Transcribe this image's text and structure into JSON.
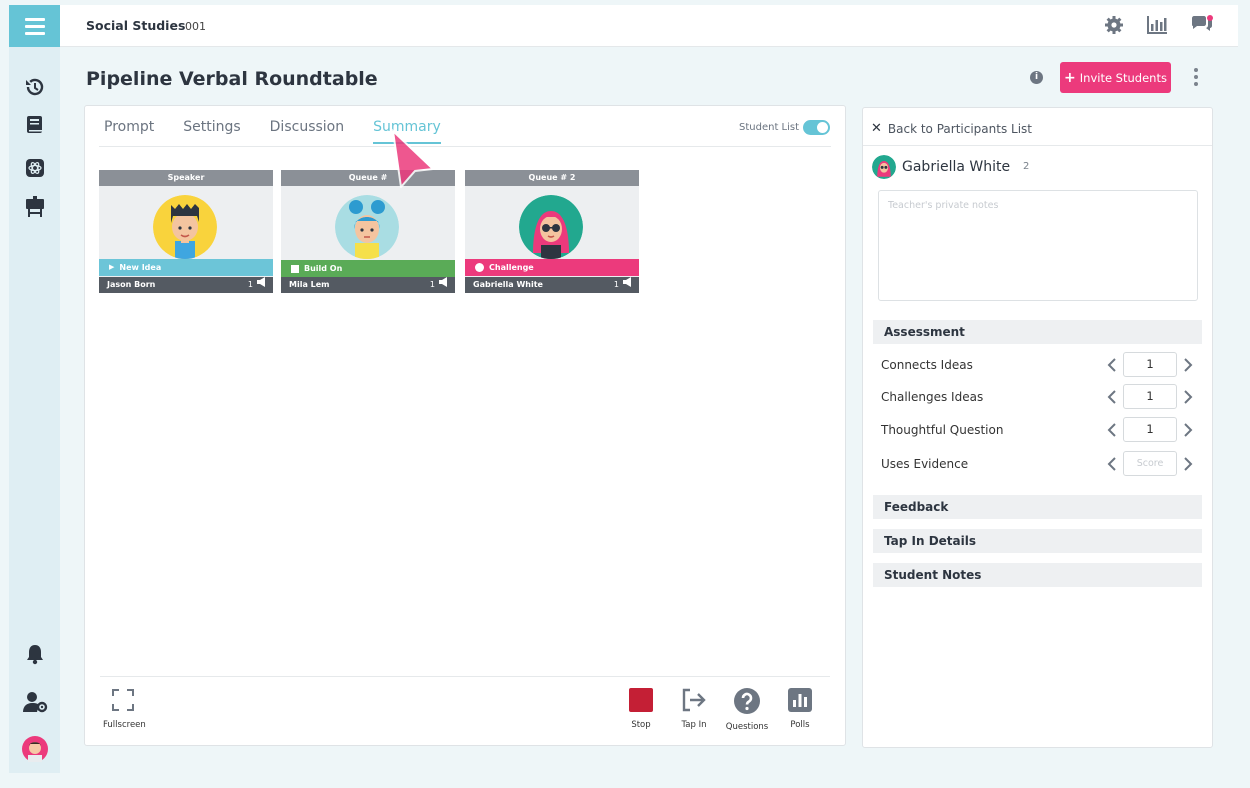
{
  "topbar": {
    "course": "Social Studies",
    "section": "001"
  },
  "page": {
    "title": "Pipeline Verbal Roundtable",
    "invite_label": "Invite Students"
  },
  "tabs": [
    {
      "label": "Prompt"
    },
    {
      "label": "Settings"
    },
    {
      "label": "Discussion"
    },
    {
      "label": "Summary"
    }
  ],
  "student_list_label": "Student List",
  "tiles": [
    {
      "header": "Speaker",
      "tag": "New Idea",
      "tag_color": "#6cc5d8",
      "name": "Jason Born",
      "count": "1"
    },
    {
      "header": "Queue #",
      "tag": "Build On",
      "tag_color": "#5aab57",
      "name": "Mila Lem",
      "count": "1"
    },
    {
      "header": "Queue # 2",
      "tag": "Challenge",
      "tag_color": "#ec3a7c",
      "name": "Gabriella White",
      "count": "1"
    }
  ],
  "tools": {
    "fullscreen": "Fullscreen",
    "stop": "Stop",
    "tap_in": "Tap In",
    "questions": "Questions",
    "polls": "Polls"
  },
  "panel": {
    "back_label": "Back to Participants List",
    "participant_name": "Gabriella White",
    "participant_count": "2",
    "notes_placeholder": "Teacher's private notes",
    "assessment_label": "Assessment",
    "criteria": [
      {
        "label": "Connects Ideas",
        "value": "1"
      },
      {
        "label": "Challenges Ideas",
        "value": "1"
      },
      {
        "label": "Thoughtful Question",
        "value": "1"
      },
      {
        "label": "Uses Evidence",
        "value": "",
        "placeholder": "Score"
      }
    ],
    "feedback_label": "Feedback",
    "tap_in_details_label": "Tap In Details",
    "student_notes_label": "Student Notes"
  },
  "colors": {
    "accent": "#65c4d6",
    "brand_pink": "#ec3a7c",
    "stop_red": "#c41f35"
  }
}
